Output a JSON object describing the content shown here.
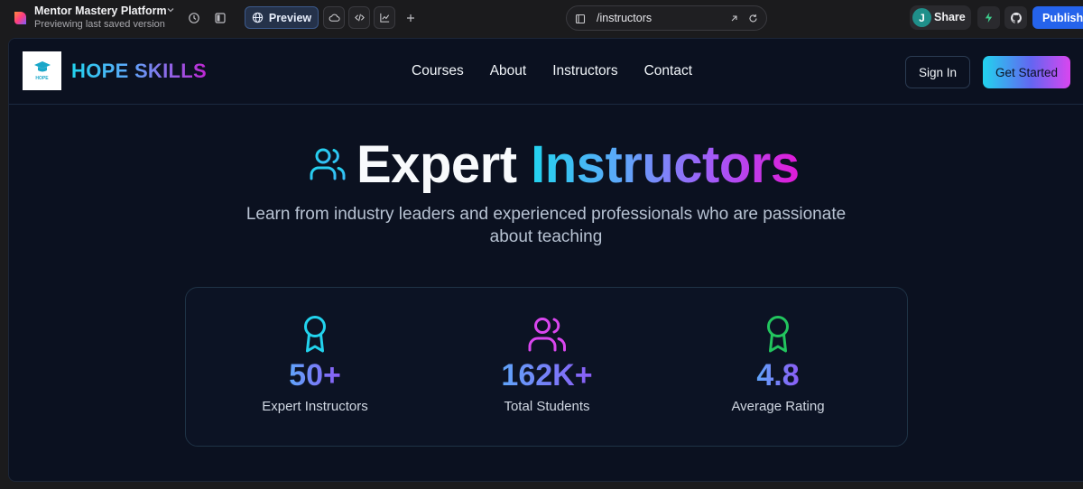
{
  "editor": {
    "project_title": "Mentor Mastery Platform",
    "project_subtitle": "Previewing last saved version",
    "preview_label": "Preview",
    "url_path": "/instructors",
    "avatar_initial": "J",
    "share_label": "Share",
    "publish_label": "Publish",
    "accent_color": "#2563eb"
  },
  "site": {
    "brand": {
      "name": "HOPE SKILLS",
      "logo_text": "HOPE"
    },
    "nav": {
      "links": [
        "Courses",
        "About",
        "Instructors",
        "Contact"
      ],
      "sign_in_label": "Sign In",
      "get_started_label": "Get Started"
    },
    "hero": {
      "title_part1": "Expert",
      "title_part2": "Instructors",
      "subtitle": "Learn from industry leaders and experienced professionals who are passionate about teaching",
      "icon": "users-icon"
    },
    "stats": [
      {
        "value": "50+",
        "label": "Expert Instructors",
        "icon": "award-icon",
        "color": "#22d3ee"
      },
      {
        "value": "162K+",
        "label": "Total Students",
        "icon": "users-icon",
        "color": "#d946ef"
      },
      {
        "value": "4.8",
        "label": "Average Rating",
        "icon": "award-icon",
        "color": "#22c55e"
      }
    ]
  }
}
